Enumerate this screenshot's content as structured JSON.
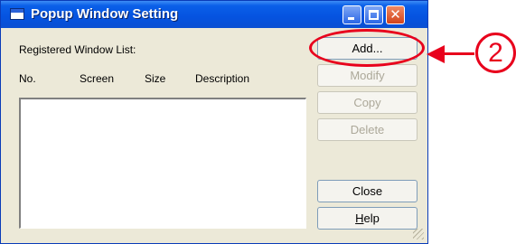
{
  "window": {
    "title": "Popup Window Setting",
    "close_glyph": "✕"
  },
  "list": {
    "label": "Registered Window List:",
    "columns": [
      "No.",
      "Screen",
      "Size",
      "Description"
    ]
  },
  "buttons": {
    "add": "Add...",
    "modify": "Modify",
    "copy": "Copy",
    "delete": "Delete",
    "close": "Close",
    "help_prefix": "H",
    "help_rest": "elp"
  },
  "annotation": {
    "number": "2",
    "color": "#e8001c"
  }
}
